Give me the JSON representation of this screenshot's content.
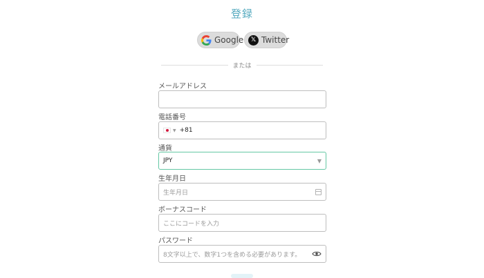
{
  "page": {
    "title": "登録"
  },
  "social": {
    "google_label": "Google",
    "twitter_label": "Twitter"
  },
  "divider": {
    "text": "または"
  },
  "form": {
    "email": {
      "label": "メールアドレス",
      "value": ""
    },
    "phone": {
      "label": "電話番号",
      "country_code": "+81",
      "flag": "japan-flag-icon"
    },
    "currency": {
      "label": "通貨",
      "value": "JPY"
    },
    "birthdate": {
      "label": "生年月日",
      "placeholder": "生年月日"
    },
    "bonus_code": {
      "label": "ボーナスコード",
      "placeholder": "ここにコードを入力"
    },
    "password": {
      "label": "パスワード",
      "placeholder": "8文字以上で、数字1つを含める必要があります。"
    }
  },
  "colors": {
    "accent": "#55aabf",
    "focus_border": "#63c7a3",
    "field_border": "#bdbdbd"
  }
}
